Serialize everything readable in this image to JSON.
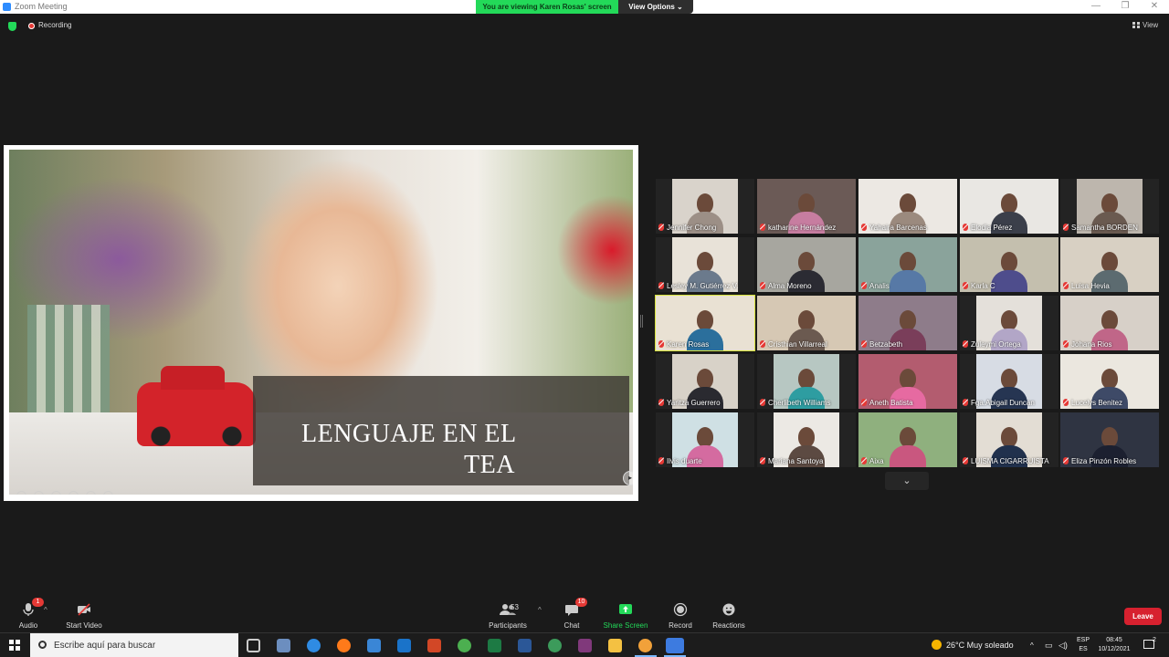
{
  "window": {
    "title": "Zoom Meeting",
    "viewing_banner": "You are viewing Karen Rosas' screen",
    "view_options_label": "View Options ⌄",
    "controls": [
      "—",
      "❐",
      "✕"
    ]
  },
  "meeting_info": {
    "recording_label": "Recording",
    "view_label": "View"
  },
  "slide": {
    "title_line1": "LENGUAJE  EN EL",
    "title_line2": "TEA"
  },
  "gallery": {
    "participants": [
      {
        "name": "Jennifer Chong"
      },
      {
        "name": "katharine Hernández"
      },
      {
        "name": "Yahaira Barcenas"
      },
      {
        "name": "Elodia Pérez"
      },
      {
        "name": "Samantha BORDEN"
      },
      {
        "name": "Lesley M. Gutiérrez V."
      },
      {
        "name": "Alma Moreno"
      },
      {
        "name": "Analis"
      },
      {
        "name": "Karla C"
      },
      {
        "name": "Luisa Hevia"
      },
      {
        "name": "Karen Rosas"
      },
      {
        "name": "Cristhian Villarreal"
      },
      {
        "name": "Betzabeth"
      },
      {
        "name": "Zuleymi Ortega"
      },
      {
        "name": "Johana Rios"
      },
      {
        "name": "Yaritza Guerrero"
      },
      {
        "name": "Cherlibeth Williams"
      },
      {
        "name": "Aneth Batista"
      },
      {
        "name": "Fga.Abigail Duncan"
      },
      {
        "name": "Lucelys Benitez"
      },
      {
        "name": "Ilvis duarte"
      },
      {
        "name": "Mariana Santoya"
      },
      {
        "name": "Aixa"
      },
      {
        "name": "LUISMA CIGARRUISTA"
      },
      {
        "name": "Eliza Pinzón Robles"
      }
    ],
    "more_label": "⌄"
  },
  "toolbar": {
    "audio_label": "Audio",
    "audio_badge": "1",
    "start_video_label": "Start Video",
    "participants_label": "Participants",
    "participants_count": "53",
    "chat_label": "Chat",
    "chat_badge": "10",
    "share_screen_label": "Share Screen",
    "record_label": "Record",
    "reactions_label": "Reactions",
    "leave_label": "Leave",
    "caret": "^"
  },
  "taskbar": {
    "search_placeholder": "Escribe aquí para buscar",
    "weather": "26°C  Muy soleado",
    "lang_line1": "ESP",
    "lang_line2": "ES",
    "time": "08:45",
    "date": "10/12/2021",
    "notification_count": "2"
  },
  "colors": {
    "banner_green": "#23d959",
    "leave_red": "#d7212f",
    "active_speaker": "#d7e23c",
    "muted_red": "#e53935"
  }
}
